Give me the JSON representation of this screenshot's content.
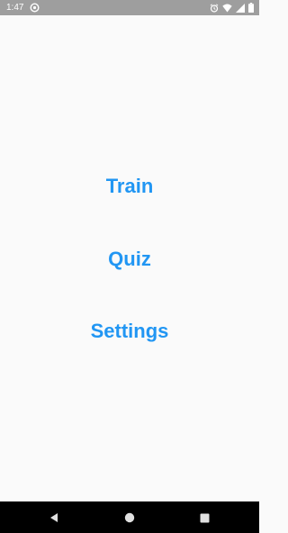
{
  "status_bar": {
    "time": "1:47",
    "icons": [
      "app-notification-icon",
      "alarm-icon",
      "wifi-icon",
      "signal-icon",
      "battery-icon"
    ]
  },
  "menu": {
    "items": [
      {
        "label": "Train"
      },
      {
        "label": "Quiz"
      },
      {
        "label": "Settings"
      }
    ],
    "accent_color": "#2196f3"
  },
  "nav_bar": {
    "icons": [
      "back-icon",
      "home-icon",
      "recents-icon"
    ]
  },
  "colors": {
    "background": "#fafafa",
    "status_bar": "#9e9e9e",
    "nav_bar": "#000000"
  }
}
